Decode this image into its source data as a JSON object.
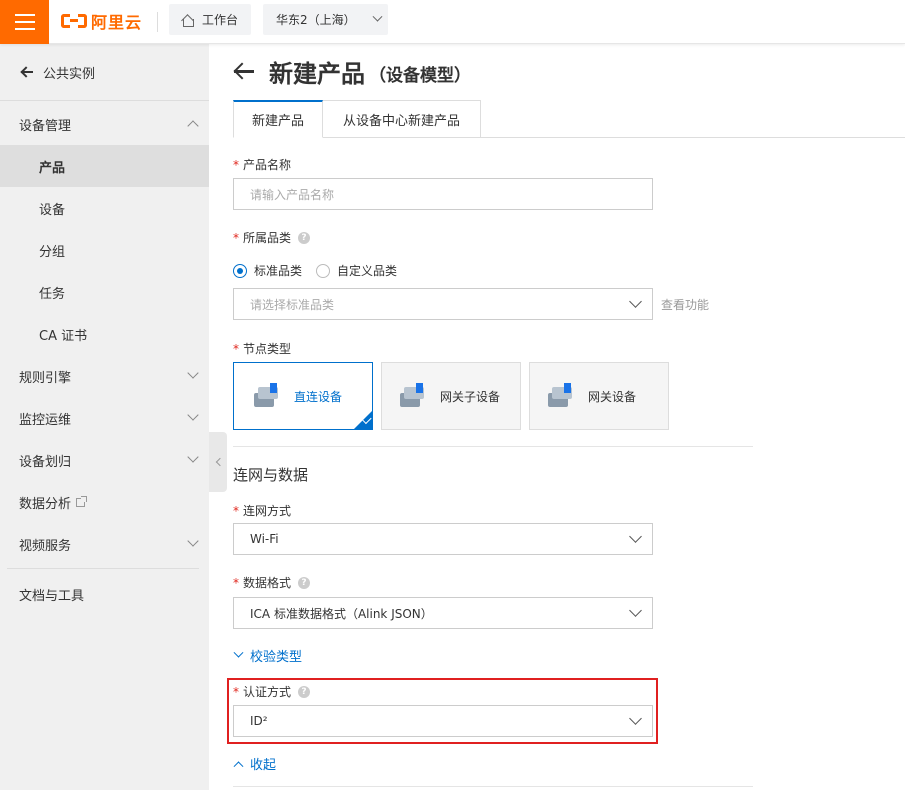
{
  "topbar": {
    "brand": "阿里云",
    "home_label": "工作台",
    "region_label": "华东2（上海）"
  },
  "sidebar": {
    "back_label": "公共实例",
    "items": [
      {
        "label": "设备管理"
      },
      {
        "label": "产品"
      },
      {
        "label": "设备"
      },
      {
        "label": "分组"
      },
      {
        "label": "任务"
      },
      {
        "label": "CA 证书"
      },
      {
        "label": "规则引擎"
      },
      {
        "label": "监控运维"
      },
      {
        "label": "设备划归"
      },
      {
        "label": "数据分析"
      },
      {
        "label": "视频服务"
      },
      {
        "label": "文档与工具"
      }
    ]
  },
  "page": {
    "title": "新建产品",
    "subtitle": "（设备模型）"
  },
  "tabs": [
    {
      "label": "新建产品",
      "active": true
    },
    {
      "label": "从设备中心新建产品",
      "active": false
    }
  ],
  "form": {
    "product_name": {
      "label": "产品名称",
      "placeholder": "请输入产品名称"
    },
    "category": {
      "label": "所属品类",
      "options": [
        "标准品类",
        "自定义品类"
      ],
      "select_placeholder": "请选择标准品类",
      "view_features": "查看功能"
    },
    "node_type": {
      "label": "节点类型",
      "cards": [
        "直连设备",
        "网关子设备",
        "网关设备"
      ]
    },
    "section_network": "连网与数据",
    "network_method": {
      "label": "连网方式",
      "value": "Wi-Fi"
    },
    "data_format": {
      "label": "数据格式",
      "value": "ICA 标准数据格式（Alink JSON）"
    },
    "verify_type_link": "校验类型",
    "auth_method": {
      "label": "认证方式",
      "value": "ID²"
    },
    "collapse_link": "收起"
  },
  "colors": {
    "accent": "#0070cc",
    "brand": "#ff6a00",
    "highlight": "#e02020"
  }
}
